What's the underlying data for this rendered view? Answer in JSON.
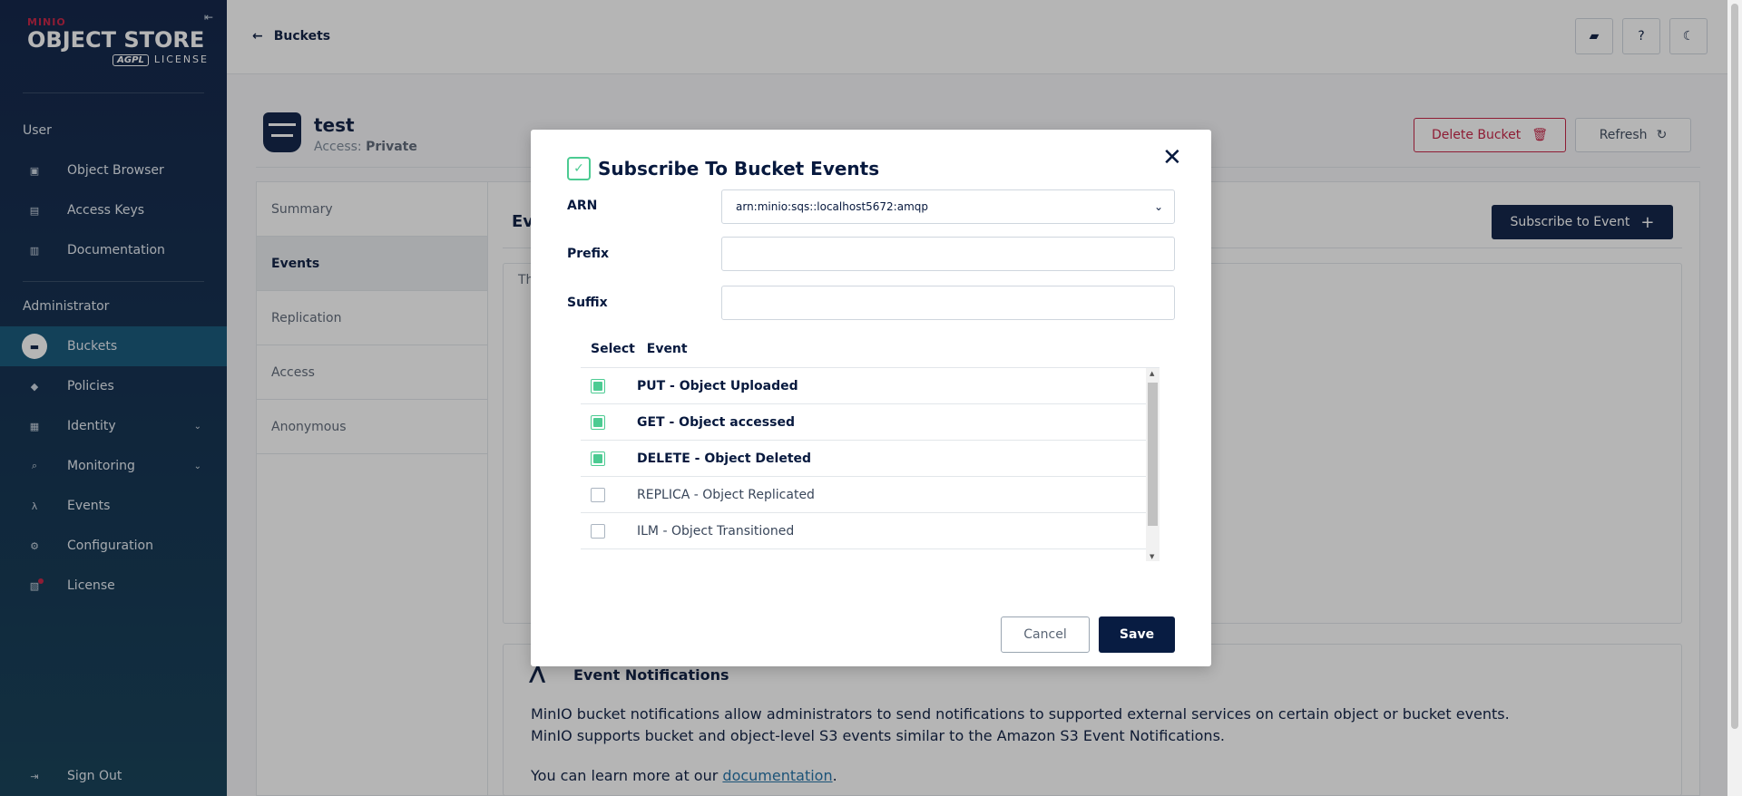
{
  "sidebar": {
    "logo": {
      "brand": "MINIO",
      "product": "OBJECT STORE",
      "agpl": "AGPL",
      "license": "LICENSE"
    },
    "sections": [
      {
        "title": "User"
      },
      {
        "title": "Administrator"
      }
    ],
    "user_items": [
      {
        "label": "Object Browser",
        "icon": "object-browser-icon"
      },
      {
        "label": "Access Keys",
        "icon": "access-keys-icon"
      },
      {
        "label": "Documentation",
        "icon": "documentation-icon"
      }
    ],
    "admin_items": [
      {
        "label": "Buckets",
        "icon": "bucket-icon",
        "active": true
      },
      {
        "label": "Policies",
        "icon": "policy-icon"
      },
      {
        "label": "Identity",
        "icon": "identity-icon"
      },
      {
        "label": "Monitoring",
        "icon": "monitoring-icon"
      },
      {
        "label": "Events",
        "icon": "lambda-icon"
      },
      {
        "label": "Configuration",
        "icon": "gear-icon"
      },
      {
        "label": "License",
        "icon": "license-icon"
      }
    ],
    "sign_out": "Sign Out"
  },
  "header": {
    "back_label": "Buckets"
  },
  "bucket": {
    "name": "test",
    "access_label": "Access:",
    "access_value": "Private",
    "delete_label": "Delete Bucket",
    "refresh_label": "Refresh"
  },
  "tabs": [
    {
      "label": "Summary"
    },
    {
      "label": "Events",
      "active": true
    },
    {
      "label": "Replication"
    },
    {
      "label": "Access"
    },
    {
      "label": "Anonymous"
    }
  ],
  "events_panel": {
    "title": "Ev",
    "subscribe_label": "Subscribe to Event",
    "table_text": "Th",
    "info_title": "Event Notifications",
    "info_text": "MinIO bucket notifications allow administrators to send notifications to supported external services on certain object or bucket events. MinIO supports bucket and object-level S3 events similar to the Amazon S3 Event Notifications.",
    "learn_more": "You can learn more at our",
    "link_text": "documentation",
    "period": "."
  },
  "modal": {
    "title": "Subscribe To Bucket Events",
    "arn_label": "ARN",
    "arn_value": "arn:minio:sqs::localhost5672:amqp",
    "prefix_label": "Prefix",
    "prefix_value": "",
    "suffix_label": "Suffix",
    "suffix_value": "",
    "col_select": "Select",
    "col_event": "Event",
    "events": [
      {
        "label": "PUT - Object Uploaded",
        "checked": true
      },
      {
        "label": "GET - Object accessed",
        "checked": true
      },
      {
        "label": "DELETE - Object Deleted",
        "checked": true
      },
      {
        "label": "REPLICA - Object Replicated",
        "checked": false
      },
      {
        "label": "ILM - Object Transitioned",
        "checked": false
      }
    ],
    "cancel_label": "Cancel",
    "save_label": "Save"
  },
  "colors": {
    "navy": "#081c42",
    "accent_green": "#4ccb92",
    "danger": "#c51b3f",
    "link": "#1b6ea5"
  }
}
